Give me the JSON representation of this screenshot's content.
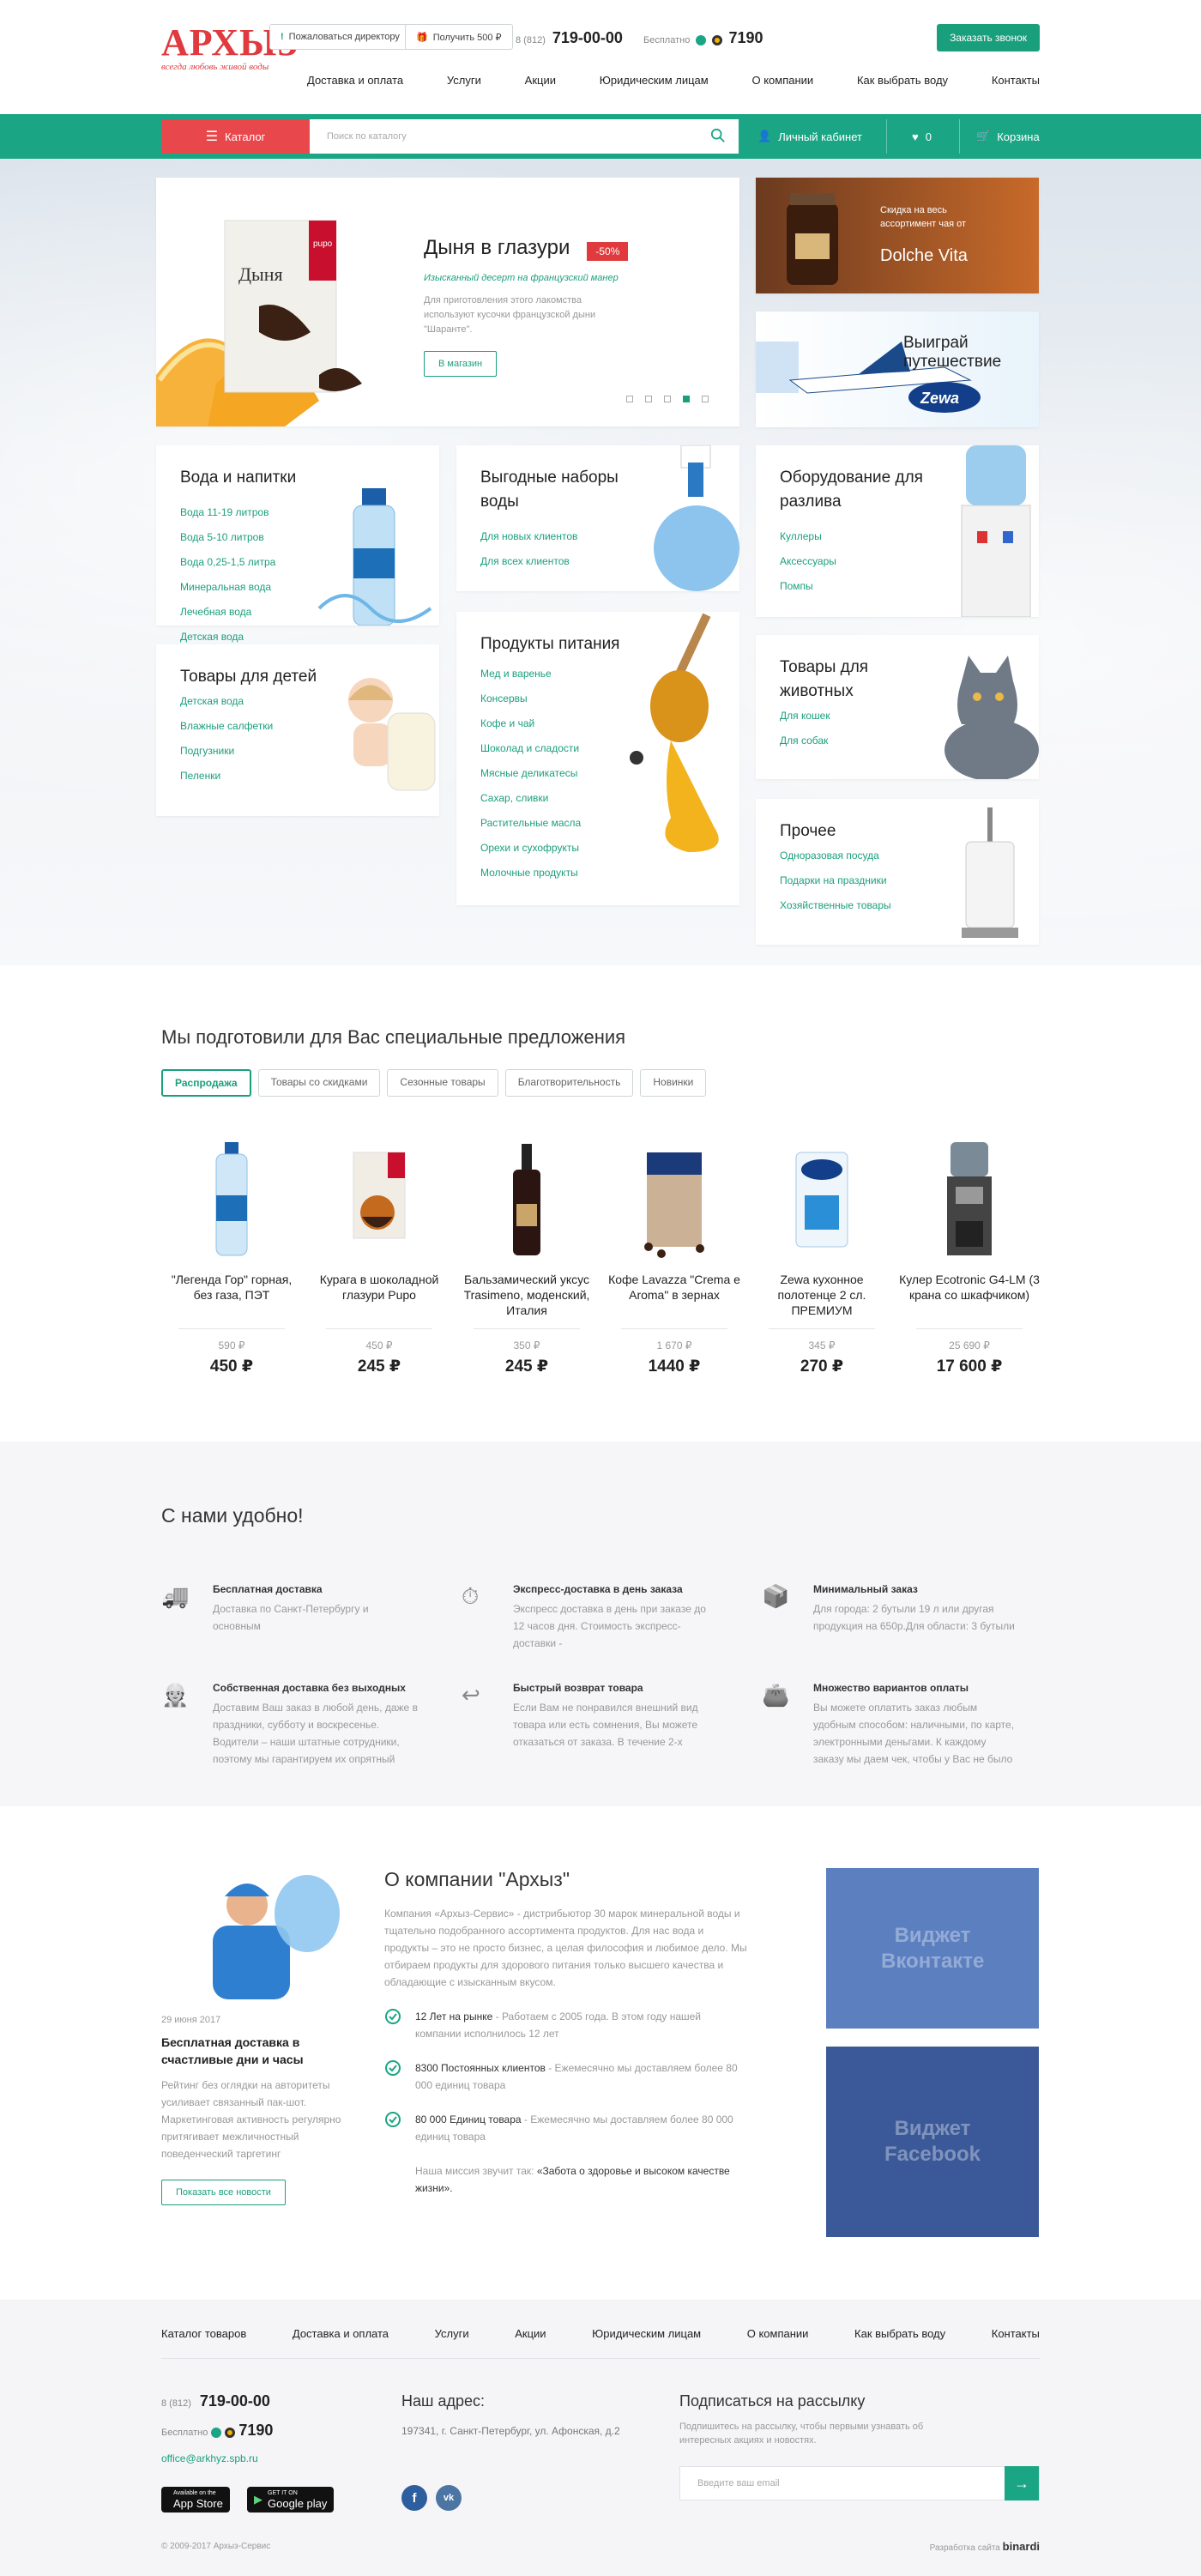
{
  "header": {
    "logo_title": "АРХЫЗ",
    "logo_tagline": "всегда любовь живой воды",
    "complain_label": "Пожаловаться директору",
    "bonus_label": "Получить 500 ₽",
    "phone_prefix": "8 (812)",
    "phone_number": "719-00-00",
    "free_label": "Бесплатно",
    "free_number": "7190",
    "call_button": "Заказать звонок",
    "nav": [
      "Доставка и оплата",
      "Услуги",
      "Акции",
      "Юридическим лицам",
      "О компании",
      "Как выбрать воду",
      "Контакты"
    ]
  },
  "toolbar": {
    "catalog_label": "Каталог",
    "search_placeholder": "Поиск по каталогу",
    "account_label": "Личный кабинет",
    "favorites_count": "0",
    "cart_label": "Корзина"
  },
  "slider": {
    "title": "Дыня в глазури",
    "badge": "-50%",
    "subtitle": "Изысканный десерт на французский манер",
    "description": "Для приготовления этого лакомства используют кусочки французской дыни \"Шаранте\".",
    "button": "В магазин",
    "package_brand": "pupo",
    "package_text": "Дыня в глазури",
    "active_slide": 4,
    "total_slides": 5
  },
  "promos": {
    "dolche": "Скидка на весь ассортимент чая от",
    "dolche_brand": "Dolche Vita",
    "zewa_title": "Выиграй путешествие",
    "zewa_brand": "Zewa"
  },
  "categories": {
    "water": {
      "title": "Вода и напитки",
      "items": [
        "Вода 11-19 литров",
        "Вода 5-10 литров",
        "Вода 0,25-1,5 литра",
        "Минеральная вода",
        "Лечебная вода",
        "Детская вода"
      ]
    },
    "sets": {
      "title": "Выгодные наборы воды",
      "items": [
        "Для новых клиентов",
        "Для всех клиентов"
      ]
    },
    "equipment": {
      "title": "Оборудование для разлива",
      "items": [
        "Куллеры",
        "Аксессуары",
        "Помпы"
      ]
    },
    "food": {
      "title": "Продукты питания",
      "items": [
        "Мед и варенье",
        "Консервы",
        "Кофе и чай",
        "Шоколад и сладости",
        "Мясные деликатесы",
        "Сахар, сливки",
        "Растительные масла",
        "Орехи и сухофрукты",
        "Молочные продукты"
      ]
    },
    "pets": {
      "title": "Товары для животных",
      "items": [
        "Для кошек",
        "Для собак"
      ]
    },
    "kids": {
      "title": "Товары для детей",
      "items": [
        "Детская вода",
        "Влажные салфетки",
        "Подгузники",
        "Пеленки"
      ]
    },
    "other": {
      "title": "Прочее",
      "items": [
        "Одноразовая посуда",
        "Подарки на праздники",
        "Хозяйственные товары"
      ]
    }
  },
  "offers": {
    "title": "Мы подготовили для Вас специальные предложения",
    "tabs": [
      "Распродажа",
      "Товары со скидками",
      "Сезонные товары",
      "Благотворительность",
      "Новинки"
    ],
    "products": [
      {
        "name": "\"Легенда Гор\" горная, без газа, ПЭТ",
        "old": "590 ₽",
        "price": "450 ₽"
      },
      {
        "name": "Курага в шоколадной глазури Pupo",
        "old": "450 ₽",
        "price": "245 ₽"
      },
      {
        "name": "Бальзамический уксус Trasimeno, моденский, Италия",
        "old": "350 ₽",
        "price": "245 ₽"
      },
      {
        "name": "Кофе Lavazza \"Crema e Aroma\" в зернах",
        "old": "1 670 ₽",
        "price": "1440 ₽"
      },
      {
        "name": "Zewa кухонное полотенце 2 сл. ПРЕМИУМ",
        "old": "345 ₽",
        "price": "270 ₽"
      },
      {
        "name": "Кулер Ecotronic G4-LM (3 крана со шкафчиком)",
        "old": "25 690 ₽",
        "price": "17 600 ₽"
      }
    ]
  },
  "convenient": {
    "title": "С нами удобно!",
    "features": [
      {
        "title": "Бесплатная доставка",
        "desc": "Доставка по Санкт-Петербургу и основным"
      },
      {
        "title": "Экспресс-доставка в день заказа",
        "desc": "Экспресс доставка в день при заказе до 12 часов дня. Стоимость экспресс-доставки -"
      },
      {
        "title": "Минимальный заказ",
        "desc": "Для города: 2 бутыли 19 л или другая продукция на 650р.Для области: 3 бутыли"
      },
      {
        "title": "Собственная доставка без выходных",
        "desc": "Доставим Ваш заказ в любой день, даже в праздники, субботу и воскресенье. Водители – наши штатные сотрудники, поэтому мы гарантируем их опрятный"
      },
      {
        "title": "Быстрый возврат товара",
        "desc": "Если Вам не понравился внешний вид товара или есть сомнения, Вы можете отказаться от заказа. В течение 2-х"
      },
      {
        "title": "Множество вариантов оплаты",
        "desc": "Вы можете оплатить заказ любым удобным способом: наличными, по карте, электронными деньгами. К каждому заказу мы даем чек, чтобы у Вас не было"
      }
    ]
  },
  "news": {
    "date": "29 июня 2017",
    "title": "Бесплатная доставка в счастливые дни и часы",
    "desc": "Рейтинг без оглядки на авторитеты усиливает связанный пак-шот. Маркетинговая активность регулярно притягивает межличностный поведенческий таргетинг",
    "button": "Показать все новости"
  },
  "about": {
    "title": "О компании \"Архыз\"",
    "desc": "Компания «Архыз-Сервис» - дистрибьютор 30 марок минеральной воды и тщательно подобранного ассортимента продуктов. Для нас вода и продукты – это не просто бизнес, а целая философия и любимое дело. Мы отбираем продукты для здорового питания только высшего качества и обладающие с изысканным вкусом.",
    "facts": [
      {
        "title": "12 Лет на рынке",
        "desc": " - Работаем с 2005 года. В этом году нашей компании исполнилось 12 лет"
      },
      {
        "title": "8300 Постоянных клиентов",
        "desc": " - Ежемесячно мы доставляем более 80 000 единиц товара"
      },
      {
        "title": "80 000 Единиц товара",
        "desc": " - Ежемесячно мы доставляем более 80 000 единиц товара"
      }
    ],
    "mission_prefix": "Наша миссия звучит так: ",
    "mission": "«Забота о здоровье и высоком качестве жизни».",
    "widget_vk": "Виджет Вконтакте",
    "widget_fb": "Виджет Facebook"
  },
  "footer": {
    "nav": [
      "Каталог товаров",
      "Доставка и оплата",
      "Услуги",
      "Акции",
      "Юридическим лицам",
      "О компании",
      "Как выбрать воду",
      "Контакты"
    ],
    "phone_prefix": "8 (812)",
    "phone_number": "719-00-00",
    "free_label": "Бесплатно",
    "free_number": "7190",
    "email": "office@arkhyz.spb.ru",
    "appstore_small": "Available on the",
    "appstore": "App Store",
    "gplay_small": "GET IT ON",
    "gplay": "Google play",
    "address_title": "Наш адрес:",
    "address": "197341, г. Санкт-Петербург, ул. Афонская, д.2",
    "subscribe_title": "Подписаться на рассылку",
    "subscribe_desc": "Подпишитесь на рассылку, чтобы первыми узнавать об интересных акциях и новостях.",
    "email_placeholder": "Введите ваш email",
    "copyright": "© 2009-2017 Архыз-Сервис",
    "dev_label": "Разработка сайта",
    "dev_brand": "binardi",
    "social_vk": "vk",
    "social_fb": "f"
  },
  "colors": {
    "accent": "#1aa584",
    "brand_red": "#e03a3e",
    "vk": "#5b7fbf",
    "fb": "#3b5998"
  }
}
